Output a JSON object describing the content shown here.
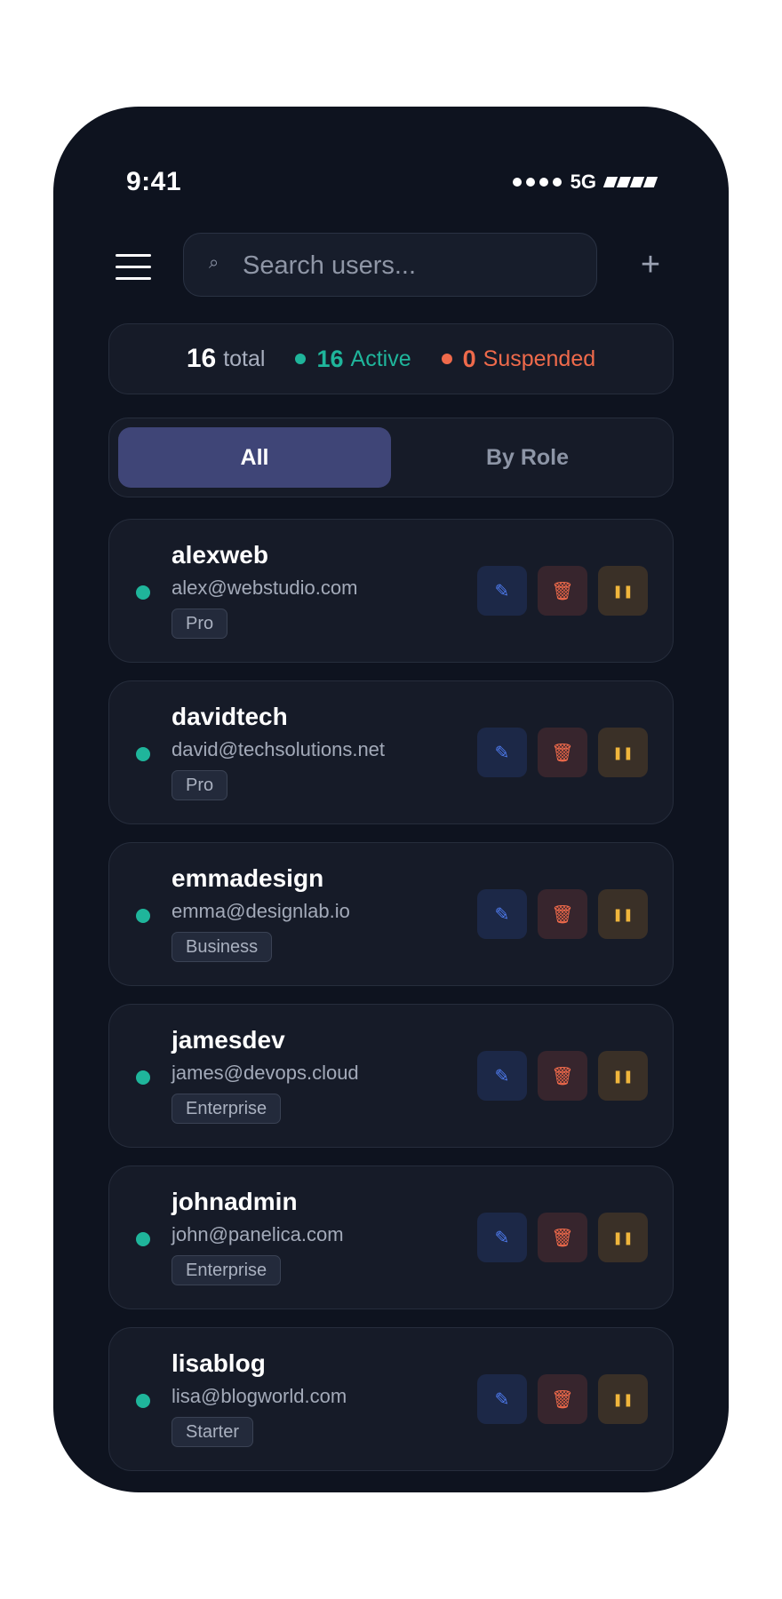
{
  "status_bar": {
    "time": "9:41",
    "network": "5G"
  },
  "search": {
    "placeholder": "Search users..."
  },
  "header": {
    "add_label": "+"
  },
  "stats": {
    "total_count": "16",
    "total_label": "total",
    "active_count": "16",
    "active_label": "Active",
    "suspended_count": "0",
    "suspended_label": "Suspended"
  },
  "tabs": [
    {
      "label": "All",
      "active": true
    },
    {
      "label": "By Role",
      "active": false
    }
  ],
  "users": [
    {
      "name": "alexweb",
      "email": "alex@webstudio.com",
      "plan": "Pro",
      "status": "active"
    },
    {
      "name": "davidtech",
      "email": "david@techsolutions.net",
      "plan": "Pro",
      "status": "active"
    },
    {
      "name": "emmadesign",
      "email": "emma@designlab.io",
      "plan": "Business",
      "status": "active"
    },
    {
      "name": "jamesdev",
      "email": "james@devops.cloud",
      "plan": "Enterprise",
      "status": "active"
    },
    {
      "name": "johnadmin",
      "email": "john@panelica.com",
      "plan": "Enterprise",
      "status": "active"
    },
    {
      "name": "lisablog",
      "email": "lisa@blogworld.com",
      "plan": "Starter",
      "status": "active"
    }
  ],
  "colors": {
    "background": "#0e131f",
    "card": "#161b28",
    "active": "#1fb59b",
    "suspended": "#ef6a4b",
    "tab_active": "#3f4577",
    "edit": "#4f7cf0",
    "delete": "#ef6a4b",
    "pause": "#f0b63c"
  },
  "icons": {
    "edit": "pencil-icon",
    "delete": "trash-icon",
    "suspend": "pause-icon"
  }
}
